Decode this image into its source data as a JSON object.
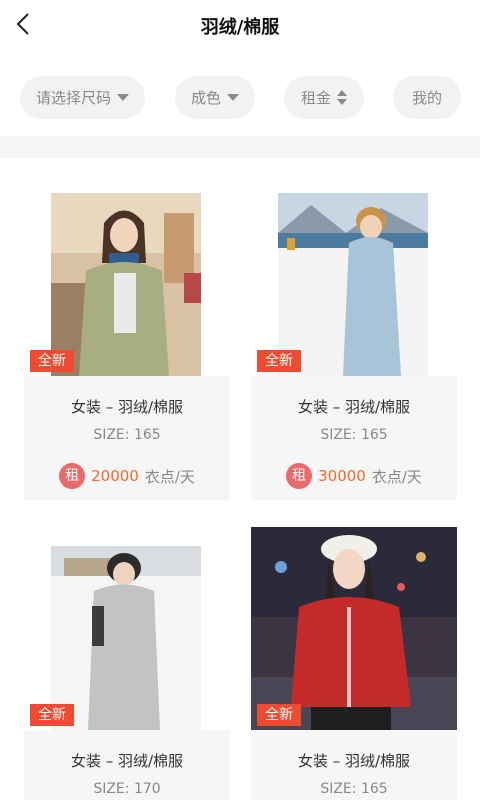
{
  "header": {
    "title": "羽绒/棉服"
  },
  "filters": {
    "size": "请选择尺码",
    "color": "成色",
    "rent": "租金",
    "mine": "我的"
  },
  "colors": {
    "accent": "#ee4b33",
    "price": "#ef6a2e",
    "rent_badge": "#e96a6a"
  },
  "products": [
    {
      "badge": "全新",
      "name": "女装 – 羽绒/棉服",
      "size": "SIZE: 165",
      "rent_tag": "租",
      "price": "20000",
      "unit": "衣点/天"
    },
    {
      "badge": "全新",
      "name": "女装 – 羽绒/棉服",
      "size": "SIZE: 165",
      "rent_tag": "租",
      "price": "30000",
      "unit": "衣点/天"
    },
    {
      "badge": "全新",
      "name": "女装 – 羽绒/棉服",
      "size": "SIZE: 170"
    },
    {
      "badge": "全新",
      "name": "女装 – 羽绒/棉服",
      "size": "SIZE: 165"
    }
  ]
}
